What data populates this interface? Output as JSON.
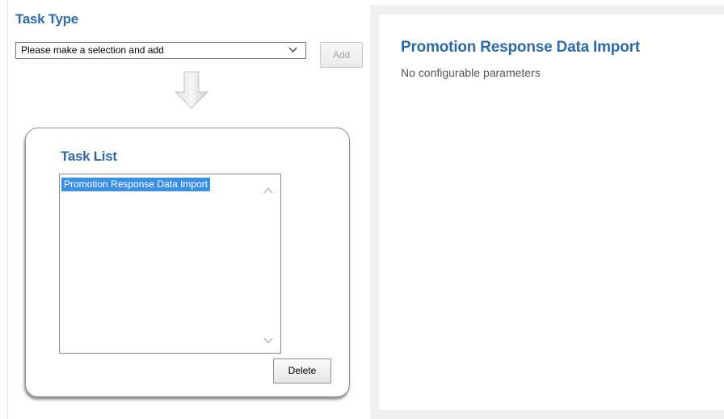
{
  "task_type": {
    "heading": "Task Type",
    "select_value": "Please make a selection and add",
    "add_label": "Add",
    "chevron_icon": "chevron-down-icon",
    "arrow_icon": "arrow-down-icon"
  },
  "task_list": {
    "heading": "Task List",
    "items": [
      "Promotion Response Data Import"
    ],
    "selected_index": 0,
    "delete_label": "Delete",
    "scroll_up_icon": "chevron-up-icon",
    "scroll_down_icon": "chevron-down-icon"
  },
  "detail": {
    "title": "Promotion Response Data Import",
    "description": "No configurable parameters"
  },
  "colors": {
    "heading": "#2d6aa8",
    "selection": "#3a8ee6",
    "frame": "#efefef"
  }
}
